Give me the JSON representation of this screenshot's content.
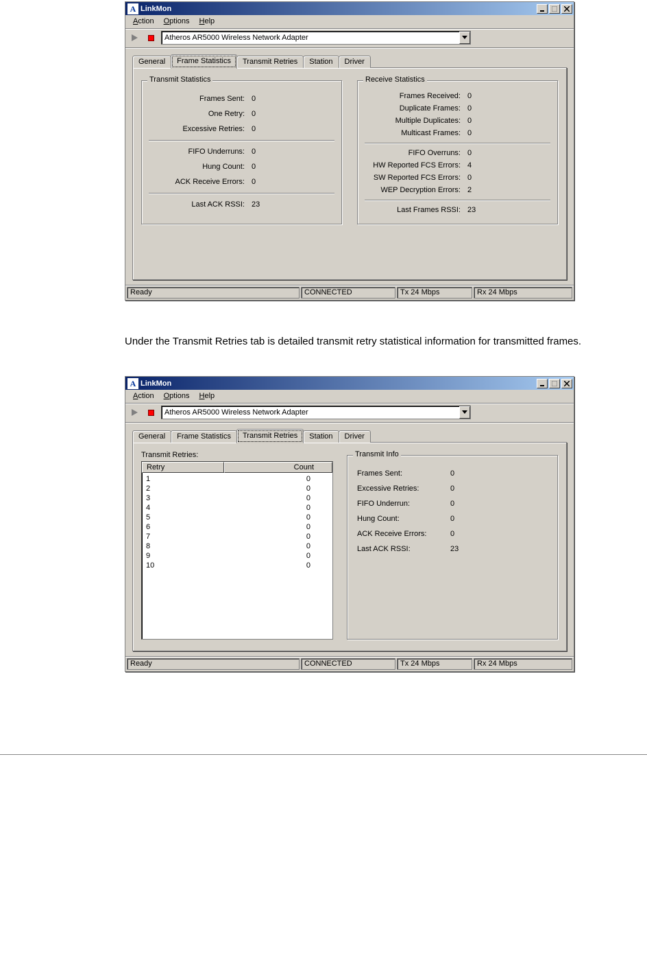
{
  "app": {
    "icon_text": "A",
    "title": "LinkMon"
  },
  "win_buttons": {
    "minimize_glyph": "_",
    "close_glyph": "×"
  },
  "menu": {
    "action": "Action",
    "options": "Options",
    "help": "Help"
  },
  "toolbar": {
    "dropdown_value": "Atheros AR5000 Wireless Network Adapter"
  },
  "tabs": {
    "general": "General",
    "frame_stats": "Frame Statistics",
    "transmit_retries": "Transmit Retries",
    "station": "Station",
    "driver": "Driver"
  },
  "frame_stats_panel": {
    "transmit_title": "Transmit Statistics",
    "receive_title": "Receive Statistics",
    "tx": {
      "frames_sent_label": "Frames Sent:",
      "frames_sent": "0",
      "one_retry_label": "One Retry:",
      "one_retry": "0",
      "excessive_label": "Excessive Retries:",
      "excessive": "0",
      "fifo_under_label": "FIFO Underruns:",
      "fifo_under": "0",
      "hung_label": "Hung Count:",
      "hung": "0",
      "ack_err_label": "ACK Receive Errors:",
      "ack_err": "0",
      "last_ack_rssi_label": "Last ACK RSSI:",
      "last_ack_rssi": "23"
    },
    "rx": {
      "frames_recv_label": "Frames Received:",
      "frames_recv": "0",
      "dup_label": "Duplicate Frames:",
      "dup": "0",
      "multi_dup_label": "Multiple Duplicates:",
      "multi_dup": "0",
      "mcast_label": "Multicast Frames:",
      "mcast": "0",
      "fifo_over_label": "FIFO Overruns:",
      "fifo_over": "0",
      "hw_fcs_label": "HW Reported FCS Errors:",
      "hw_fcs": "4",
      "sw_fcs_label": "SW Reported FCS Errors:",
      "sw_fcs": "0",
      "wep_label": "WEP Decryption Errors:",
      "wep": "2",
      "last_frames_rssi_label": "Last Frames RSSI:",
      "last_frames_rssi": "23"
    }
  },
  "status": {
    "ready": "Ready",
    "connected": "CONNECTED",
    "tx": "Tx 24 Mbps",
    "rx": "Rx 24 Mbps"
  },
  "caption_text": "Under the Transmit Retries tab is detailed transmit retry statistical information for transmitted frames.",
  "retries_panel": {
    "caption": "Transmit Retries:",
    "col_retry": "Retry",
    "col_count": "Count",
    "rows": [
      {
        "retry": "1",
        "count": "0"
      },
      {
        "retry": "2",
        "count": "0"
      },
      {
        "retry": "3",
        "count": "0"
      },
      {
        "retry": "4",
        "count": "0"
      },
      {
        "retry": "5",
        "count": "0"
      },
      {
        "retry": "6",
        "count": "0"
      },
      {
        "retry": "7",
        "count": "0"
      },
      {
        "retry": "8",
        "count": "0"
      },
      {
        "retry": "9",
        "count": "0"
      },
      {
        "retry": "10",
        "count": "0"
      }
    ],
    "info_title": "Transmit Info",
    "info": {
      "frames_sent_label": "Frames Sent:",
      "frames_sent": "0",
      "excessive_label": "Excessive Retries:",
      "excessive": "0",
      "fifo_label": "FIFO Underrun:",
      "fifo": "0",
      "hung_label": "Hung Count:",
      "hung": "0",
      "ack_label": "ACK Receive Errors:",
      "ack": "0",
      "rssi_label": "Last ACK RSSI:",
      "rssi": "23"
    }
  }
}
